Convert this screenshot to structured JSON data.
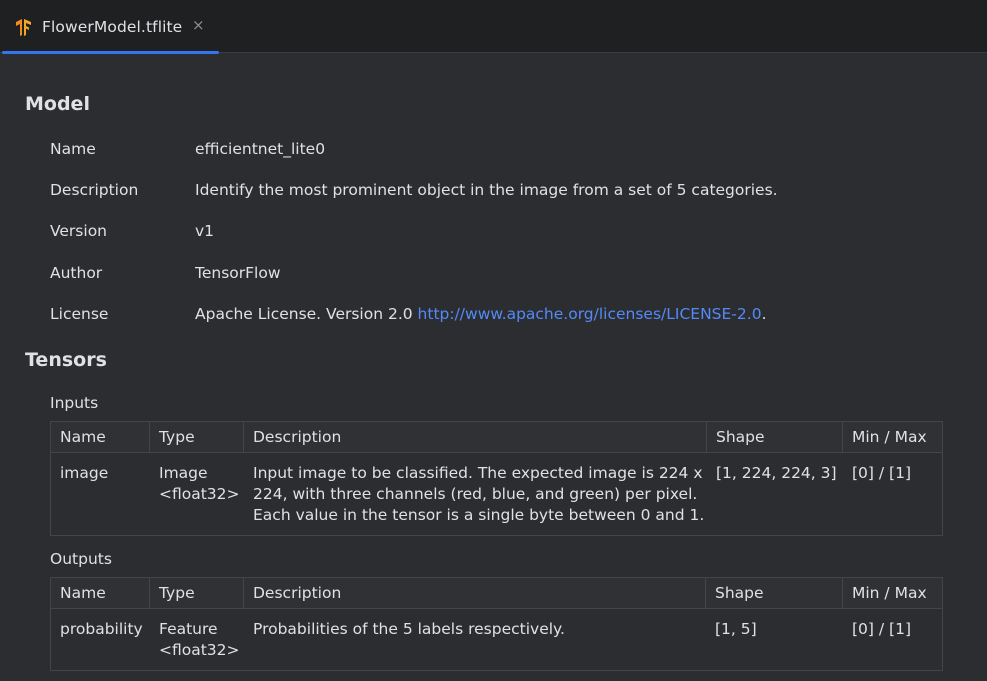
{
  "tab": {
    "icon": "tensorflow-logo-icon",
    "label": "FlowerModel.tflite",
    "close": "×"
  },
  "model": {
    "title": "Model",
    "fields": [
      {
        "label": "Name",
        "value": "efficientnet_lite0"
      },
      {
        "label": "Description",
        "value": "Identify the most prominent object in the image from a set of 5 categories."
      },
      {
        "label": "Version",
        "value": "v1"
      },
      {
        "label": "Author",
        "value": "TensorFlow"
      },
      {
        "label": "License",
        "value": "Apache License. Version 2.0 ",
        "link": "http://www.apache.org/licenses/LICENSE-2.0",
        "suffix": "."
      }
    ]
  },
  "tensors": {
    "title": "Tensors",
    "columns": [
      "Name",
      "Type",
      "Description",
      "Shape",
      "Min / Max"
    ],
    "inputs": {
      "label": "Inputs",
      "rows": [
        {
          "name": "image",
          "type_line1": "Image",
          "type_line2": "<float32>",
          "desc_line1": "Input image to be classified. The expected image is 224 x",
          "desc_line2": "224, with three channels (red, blue, and green) per pixel.",
          "desc_line3": "Each value in the tensor is a single byte between 0 and 1.",
          "shape": "[1, 224, 224, 3]",
          "minmax": "[0] / [1]"
        }
      ]
    },
    "outputs": {
      "label": "Outputs",
      "rows": [
        {
          "name": "probability",
          "type_line1": "Feature",
          "type_line2": "<float32>",
          "desc_line1": "Probabilities of the 5 labels respectively.",
          "shape": "[1, 5]",
          "minmax": "[0] / [1]"
        }
      ]
    }
  }
}
